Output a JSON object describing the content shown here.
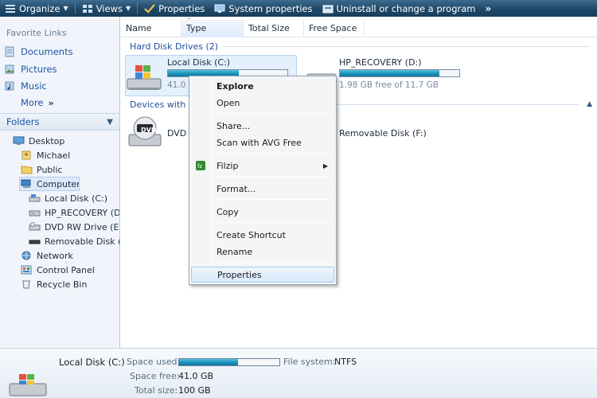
{
  "toolbar": {
    "organize": "Organize",
    "views": "Views",
    "properties": "Properties",
    "system_properties": "System properties",
    "uninstall": "Uninstall or change a program",
    "more": "»"
  },
  "nav": {
    "favorite_links_title": "Favorite Links",
    "favorites": [
      {
        "label": "Documents",
        "icon": "documents-icon"
      },
      {
        "label": "Pictures",
        "icon": "pictures-icon"
      },
      {
        "label": "Music",
        "icon": "music-icon"
      },
      {
        "label": "More",
        "icon": ""
      }
    ],
    "more_arrows": "»",
    "folders_title": "Folders",
    "tree": [
      {
        "label": "Desktop",
        "indent": 0
      },
      {
        "label": "Michael",
        "indent": 1
      },
      {
        "label": "Public",
        "indent": 1
      },
      {
        "label": "Computer",
        "indent": 1,
        "selected": true
      },
      {
        "label": "Local Disk (C:)",
        "indent": 2
      },
      {
        "label": "HP_RECOVERY (D:",
        "indent": 2
      },
      {
        "label": "DVD RW Drive (E:)",
        "indent": 2
      },
      {
        "label": "Removable Disk (F",
        "indent": 2
      },
      {
        "label": "Network",
        "indent": 1
      },
      {
        "label": "Control Panel",
        "indent": 1
      },
      {
        "label": "Recycle Bin",
        "indent": 1
      }
    ]
  },
  "columns": [
    "Name",
    "Type",
    "Total Size",
    "Free Space"
  ],
  "groups": {
    "hard_disks": "Hard Disk Drives (2)",
    "removable": "Devices with R"
  },
  "drives": {
    "c_name": "Local Disk (C:)",
    "c_free_partial": "41.0",
    "c_used_fraction": 0.59,
    "d_name": "HP_RECOVERY (D:)",
    "d_free": "1.98 GB free of 11.7 GB",
    "d_used_fraction": 0.83,
    "dvd_name": "DVD I",
    "removable_name": "Removable Disk (F:)",
    "dvd_badge": "DVD"
  },
  "context_menu": {
    "explore": "Explore",
    "open": "Open",
    "share": "Share...",
    "scan": "Scan with AVG Free",
    "filzip": "Filzip",
    "format": "Format...",
    "copy": "Copy",
    "create_shortcut": "Create Shortcut",
    "rename": "Rename",
    "properties": "Properties"
  },
  "details": {
    "name": "Local Disk (C:)",
    "space_used_label": "Space used:",
    "file_system_label": "File system:",
    "file_system_value": "NTFS",
    "space_free_label": "Space free:",
    "space_free_value": "41.0 GB",
    "total_size_label": "Total size:",
    "total_size_value": "100 GB",
    "used_fraction": 0.59
  },
  "colors": {
    "toolbar_bg": "#1f4868",
    "link_blue": "#1a55a8",
    "bar_fill": "#178fb6",
    "selection": "#dbe9fb"
  }
}
